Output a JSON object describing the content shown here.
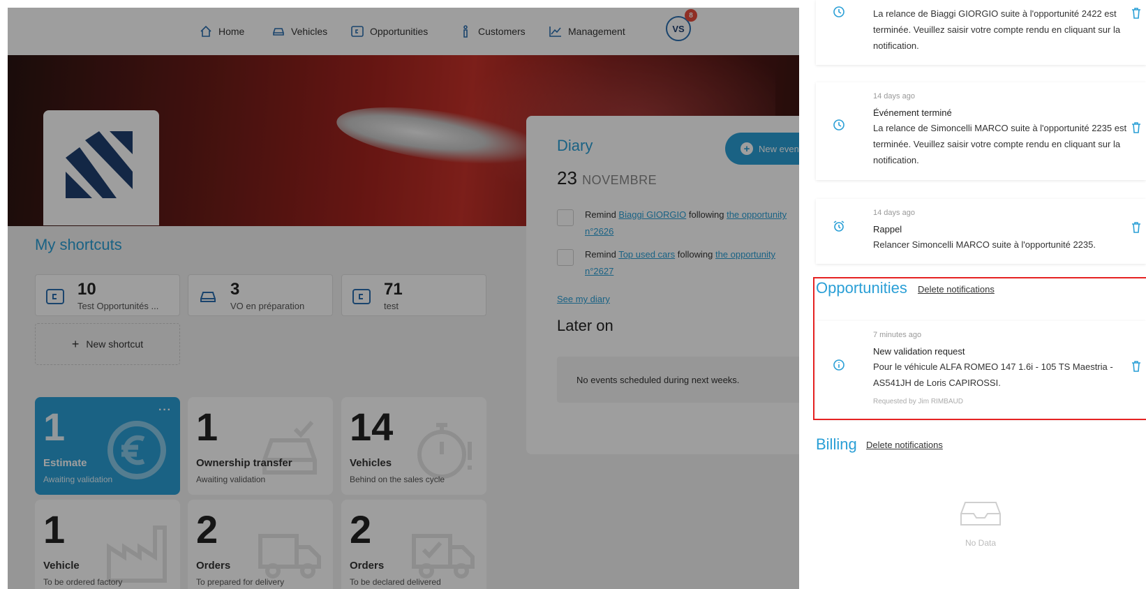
{
  "nav": {
    "items": [
      {
        "label": "Home",
        "icon": "home-icon"
      },
      {
        "label": "Vehicles",
        "icon": "car-icon"
      },
      {
        "label": "Opportunities",
        "icon": "wallet-icon"
      },
      {
        "label": "Customers",
        "icon": "person-icon"
      },
      {
        "label": "Management",
        "icon": "chart-line-icon"
      }
    ],
    "avatar_initials": "VS",
    "avatar_badge": "8"
  },
  "shortcuts": {
    "title": "My shortcuts",
    "items": [
      {
        "value": "10",
        "label": "Test Opportunités ...",
        "icon": "wallet-icon"
      },
      {
        "value": "3",
        "label": "VO en préparation",
        "icon": "car-icon"
      },
      {
        "value": "71",
        "label": "test",
        "icon": "wallet-icon"
      }
    ],
    "new_label": "New shortcut"
  },
  "stats": [
    {
      "value": "1",
      "title": "Estimate",
      "subtitle": "Awaiting validation",
      "icon": "euro-refresh-icon",
      "highlighted": true
    },
    {
      "value": "1",
      "title": "Ownership transfer",
      "subtitle": "Awaiting validation",
      "icon": "car-check-icon"
    },
    {
      "value": "14",
      "title": "Vehicles",
      "subtitle": "Behind on the sales cycle",
      "icon": "stopwatch-icon"
    },
    {
      "value": "1",
      "title": "Vehicle",
      "subtitle": "To be ordered factory",
      "icon": "factory-icon"
    },
    {
      "value": "2",
      "title": "Orders",
      "subtitle": "To prepared for delivery",
      "icon": "truck-icon"
    },
    {
      "value": "2",
      "title": "Orders",
      "subtitle": "To be declared delivered",
      "icon": "truck-check-icon"
    }
  ],
  "diary": {
    "title": "Diary",
    "new_event_label": "New event",
    "date_day": "23",
    "date_month": "NOVEMBRE",
    "items": [
      {
        "prefix": "Remind",
        "contact": "Biaggi GIORGIO",
        "middle": "following",
        "link": "the opportunity n°2626"
      },
      {
        "prefix": "Remind",
        "contact": "Top used cars",
        "middle": "following",
        "link": "the opportunity n°2627"
      }
    ],
    "see_diary": "See my diary",
    "later_on": "Later on",
    "no_events": "No events scheduled during next weeks."
  },
  "notifications": {
    "top": [
      {
        "time": "",
        "title": "",
        "body": "La relance de Biaggi GIORGIO suite à l'opportunité 2422 est terminée. Veuillez saisir votre compte rendu en cliquant sur la notification.",
        "icon": "clock-icon"
      },
      {
        "time": "14 days ago",
        "title": "Événement terminé",
        "body": "La relance de Simoncelli MARCO suite à l'opportunité 2235 est terminée. Veuillez saisir votre compte rendu en cliquant sur la notification.",
        "icon": "clock-icon"
      },
      {
        "time": "14 days ago",
        "title": "Rappel",
        "body": "Relancer Simoncelli MARCO suite à l'opportunité 2235.",
        "icon": "alarm-icon"
      }
    ],
    "opportunities": {
      "title": "Opportunities",
      "delete_label": "Delete notifications",
      "item": {
        "time": "7 minutes ago",
        "title": "New validation request",
        "body": "Pour le véhicule ALFA ROMEO 147 1.6i - 105 TS Maestria - AS541JH de Loris CAPIROSSI.",
        "requested_by": "Requested by Jim RIMBAUD",
        "icon": "info-icon"
      }
    },
    "billing": {
      "title": "Billing",
      "delete_label": "Delete notifications",
      "empty_label": "No Data",
      "empty_icon": "inbox-icon"
    }
  },
  "colors": {
    "accent": "#2a9fd6",
    "highlight": "#e52222",
    "badge": "#e74c3c",
    "brand_dark": "#1f3f70"
  }
}
